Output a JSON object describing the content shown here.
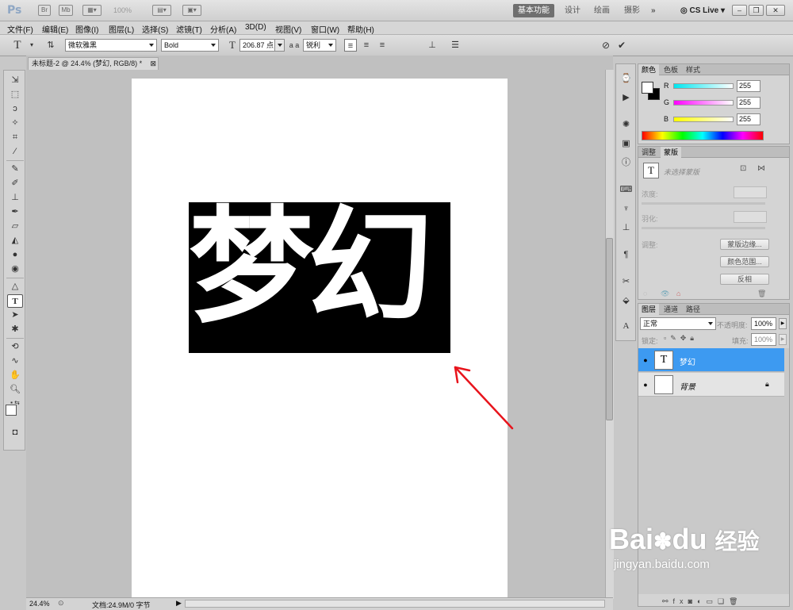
{
  "app": {
    "logo": "Ps",
    "zoom_display": "100%",
    "workspaces": [
      "基本功能",
      "设计",
      "绘画",
      "摄影"
    ],
    "overflow": "»",
    "cs_live": "CS Live"
  },
  "menu": [
    "文件(F)",
    "编辑(E)",
    "图像(I)",
    "图层(L)",
    "选择(S)",
    "滤镜(T)",
    "分析(A)",
    "3D(D)",
    "视图(V)",
    "窗口(W)",
    "帮助(H)"
  ],
  "options": {
    "font_family": "微软雅黑",
    "font_style": "Bold",
    "font_size": "206.87 点",
    "aa_label": "a a",
    "antialias": "锐利",
    "text_color": "#000000"
  },
  "document": {
    "tab_title": "未标题-2 @ 24.4% (梦幻, RGB/8) *",
    "text": "梦幻",
    "zoom": "24.4%",
    "doc_info": "文档:24.9M/0 字节"
  },
  "color_panel": {
    "tabs": [
      "颜色",
      "色板",
      "样式"
    ],
    "channels": [
      {
        "label": "R",
        "value": "255",
        "gradient": "#00e5f0"
      },
      {
        "label": "G",
        "value": "255",
        "gradient": "#ff00ff"
      },
      {
        "label": "B",
        "value": "255",
        "gradient": "#ffff00"
      }
    ]
  },
  "masks_panel": {
    "tabs": [
      "调整",
      "蒙版"
    ],
    "status": "未选择蒙版",
    "density_label": "浓度:",
    "feather_label": "羽化:",
    "refine_label": "调整:",
    "buttons": [
      "蒙版边缘...",
      "颜色范围...",
      "反相"
    ]
  },
  "layers_panel": {
    "tabs": [
      "图层",
      "通道",
      "路径"
    ],
    "blend_mode": "正常",
    "opacity_label": "不透明度:",
    "opacity": "100%",
    "lock_label": "锁定:",
    "fill_label": "填充:",
    "fill": "100%",
    "layers": [
      {
        "name": "梦幻",
        "type": "text",
        "selected": true
      },
      {
        "name": "背景",
        "type": "background",
        "selected": false
      }
    ]
  },
  "watermark": {
    "brand": "Bai",
    "brand_tail": "du",
    "cn": "经验",
    "url": "jingyan.baidu.com"
  }
}
